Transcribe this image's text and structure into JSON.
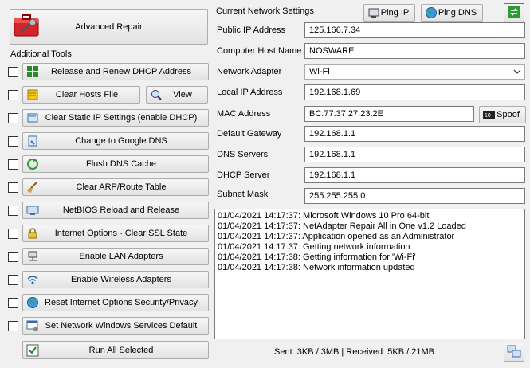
{
  "tools": {
    "advanced_repair": "Advanced Repair",
    "section_label": "Additional Tools",
    "items": [
      {
        "label": "Release and Renew DHCP Address",
        "icon": "dhcp-icon"
      },
      {
        "label": "Clear Hosts File",
        "icon": "hosts-file-icon"
      },
      {
        "label": "Clear Static IP Settings (enable DHCP)",
        "icon": "static-ip-icon"
      },
      {
        "label": "Change to Google DNS",
        "icon": "dns-icon"
      },
      {
        "label": "Flush DNS Cache",
        "icon": "flush-icon"
      },
      {
        "label": "Clear ARP/Route Table",
        "icon": "broom-icon"
      },
      {
        "label": "NetBIOS Reload and Release",
        "icon": "netbios-icon"
      },
      {
        "label": "Internet Options - Clear SSL State",
        "icon": "lock-icon"
      },
      {
        "label": "Enable LAN Adapters",
        "icon": "lan-icon"
      },
      {
        "label": "Enable Wireless Adapters",
        "icon": "wireless-icon"
      },
      {
        "label": "Reset Internet Options Security/Privacy",
        "icon": "globe-icon"
      },
      {
        "label": "Set Network Windows Services Default",
        "icon": "services-icon"
      }
    ],
    "view_label": "View",
    "run_all": "Run All Selected"
  },
  "network": {
    "title": "Current Network Settings",
    "ping_ip": "Ping IP",
    "ping_dns": "Ping DNS",
    "spoof": "Spoof",
    "fields": {
      "public_ip": {
        "label": "Public IP Address",
        "value": "125.166.7.34"
      },
      "host_name": {
        "label": "Computer Host Name",
        "value": "NOSWARE"
      },
      "adapter": {
        "label": "Network Adapter",
        "value": "Wi-Fi"
      },
      "local_ip": {
        "label": "Local IP Address",
        "value": "192.168.1.69"
      },
      "mac": {
        "label": "MAC Address",
        "value": "BC:77:37:27:23:2E"
      },
      "gateway": {
        "label": "Default Gateway",
        "value": "192.168.1.1"
      },
      "dns": {
        "label": "DNS Servers",
        "value": "192.168.1.1"
      },
      "dhcp": {
        "label": "DHCP Server",
        "value": "192.168.1.1"
      },
      "subnet": {
        "label": "Subnet Mask",
        "value": "255.255.255.0"
      }
    }
  },
  "log": [
    "01/04/2021 14:17:37: Microsoft Windows 10 Pro 64-bit",
    "01/04/2021 14:17:37: NetAdapter Repair All in One v1.2 Loaded",
    "01/04/2021 14:17:37: Application opened as an Administrator",
    "01/04/2021 14:17:37: Getting network information",
    "01/04/2021 14:17:38: Getting information for 'Wi-Fi'",
    "01/04/2021 14:17:38: Network information updated"
  ],
  "status": "Sent: 3KB / 3MB | Received: 5KB / 21MB"
}
